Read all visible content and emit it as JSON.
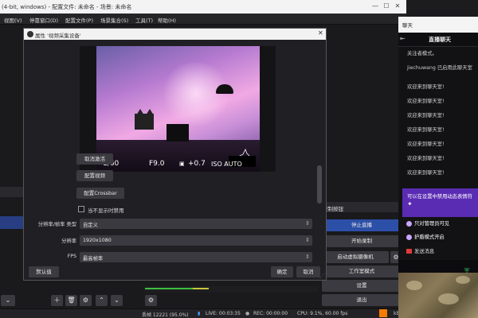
{
  "main_window": {
    "title": "(4-bit, windows) - 配置文件: 未命名 - 场景: 未命名",
    "menu": [
      "视图(V)",
      "停靠窗口(D)",
      "配置文件(P)",
      "场景集合(S)",
      "工具(T)",
      "帮助(H)"
    ]
  },
  "docks": {
    "controls_title": "控制按钮",
    "controls": {
      "stop_stream": "停止直播",
      "start_recording": "开始录制",
      "virtual_camera": "启动虚拟摄像机",
      "studio_mode": "工作室模式",
      "settings": "设置",
      "exit": "退出"
    }
  },
  "status_bar": {
    "dropped_frames": "丢帧 12221 (95.0%)",
    "live": "LIVE: 00:03:35",
    "rec": "REC: 00:00:00",
    "cpu": "CPU: 9.1%, 60.00 fps",
    "bitrate": "kb/s: 756"
  },
  "chat": {
    "window_title": "聊天",
    "header_title": "直播聊天",
    "messages": [
      "关注者模式。",
      "jiechuwang 已启用此聊天室",
      "欢迎来到聊天室!",
      "欢迎来到聊天室!",
      "欢迎来到聊天室!",
      "欢迎来到聊天室!",
      "欢迎来到聊天室!",
      "欢迎来到聊天室!",
      "欢迎来到聊天室!"
    ],
    "notice": "可以在设置中禁用动态表情符",
    "options": {
      "mod_only": "只对管理员可见",
      "shield_mode": "护盾模式开启"
    },
    "send_placeholder": "发送消息"
  },
  "dialog": {
    "title": "属性 '视频采集设备'",
    "camera_overlay": {
      "shutter": "1/60",
      "aperture": "F9.0",
      "exposure": "+0.7",
      "iso": "ISO AUTO"
    },
    "buttons": {
      "deactivate": "取消激活",
      "configure_video": "配置视频",
      "configure_crossbar": "配置Crossbar"
    },
    "checkbox_label": "当不显示时禁用",
    "rows": [
      {
        "label": "分辨率/帧率 类型",
        "value": "自定义"
      },
      {
        "label": "分辨率",
        "value": "1920x1080"
      },
      {
        "label": "FPS",
        "value": "最高帧率"
      }
    ],
    "footer": {
      "defaults": "默认值",
      "ok": "确定",
      "cancel": "取消"
    }
  },
  "colors": {
    "accent_purple": "#5a2bb3",
    "accent_blue": "#2c4fa8",
    "recording_orange": "#f57c00"
  }
}
